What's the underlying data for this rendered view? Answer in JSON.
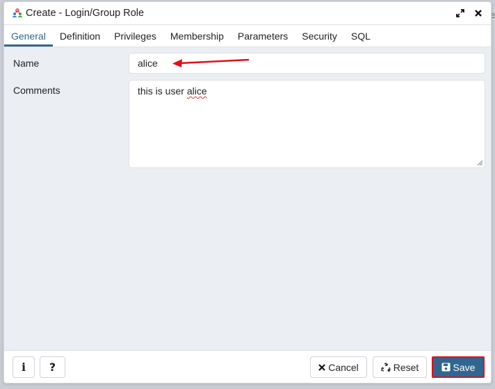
{
  "dialog": {
    "title": "Create - Login/Group Role",
    "title_icon": "login-group-role-icon",
    "window_controls": {
      "maximize_icon": "expand-arrows-icon",
      "close_icon": "close-icon"
    }
  },
  "background": {
    "partial_text": "e"
  },
  "tabs": [
    {
      "label": "General",
      "active": true
    },
    {
      "label": "Definition",
      "active": false
    },
    {
      "label": "Privileges",
      "active": false
    },
    {
      "label": "Membership",
      "active": false
    },
    {
      "label": "Parameters",
      "active": false
    },
    {
      "label": "Security",
      "active": false
    },
    {
      "label": "SQL",
      "active": false
    }
  ],
  "form": {
    "name_label": "Name",
    "name_value": "alice",
    "comments_label": "Comments",
    "comments_value_prefix": "this is user ",
    "comments_value_misspelled": "alice"
  },
  "annotation": {
    "arrow_color": "#e0101a",
    "points_to": "name-input"
  },
  "footer": {
    "info_label": "i",
    "help_label": "?",
    "cancel_label": "Cancel",
    "reset_label": "Reset",
    "save_label": "Save",
    "save_highlight_color": "#e0101a"
  },
  "colors": {
    "accent": "#326690",
    "panel_bg": "#ebeef3"
  }
}
